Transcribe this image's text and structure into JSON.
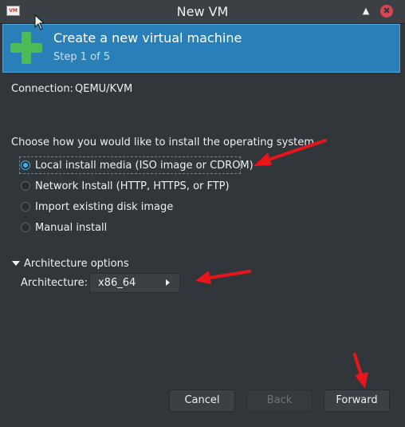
{
  "window": {
    "title": "New VM",
    "app_icon_text": "VM",
    "keep_above_icon": "▲",
    "close_icon": "✖"
  },
  "banner": {
    "title": "Create a new virtual machine",
    "step": "Step 1 of 5",
    "icon": "plus-icon"
  },
  "connection": {
    "label": "Connection:",
    "value": "QEMU/KVM"
  },
  "install": {
    "prompt": "Choose how you would like to install the operating system",
    "options": [
      {
        "label": "Local install media (ISO image or CDROM)",
        "selected": true
      },
      {
        "label": "Network Install (HTTP, HTTPS, or FTP)",
        "selected": false
      },
      {
        "label": "Import existing disk image",
        "selected": false
      },
      {
        "label": "Manual install",
        "selected": false
      }
    ]
  },
  "architecture": {
    "expander_label": "Architecture options",
    "label": "Architecture:",
    "value": "x86_64"
  },
  "buttons": {
    "cancel": "Cancel",
    "back": "Back",
    "forward": "Forward"
  },
  "colors": {
    "window_bg": "#31363b",
    "banner_bg": "#2980b9",
    "accent": "#3daee9",
    "annotation_arrow": "#e8161a",
    "close_button": "#da4453"
  }
}
